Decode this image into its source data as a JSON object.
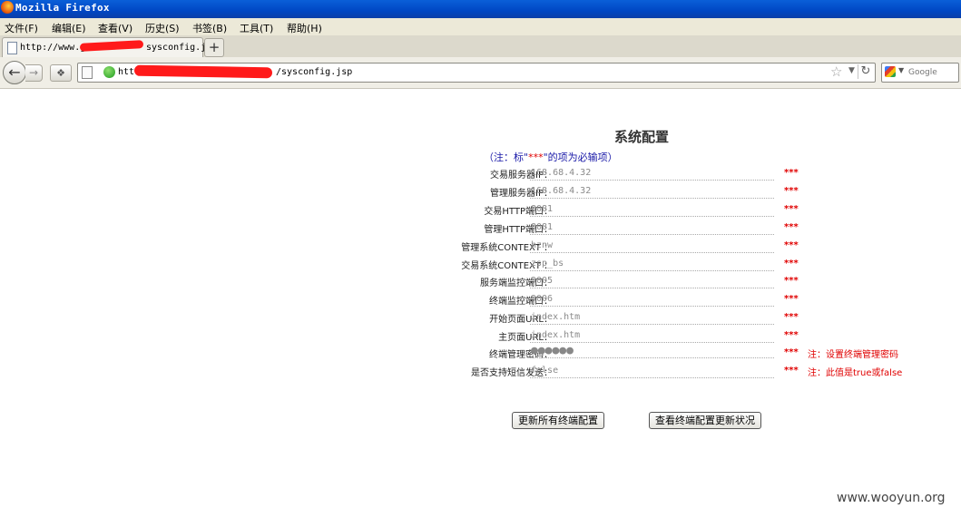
{
  "window": {
    "title": "Mozilla Firefox"
  },
  "menubar": {
    "items": [
      "文件(F)",
      "编辑(E)",
      "查看(V)",
      "历史(S)",
      "书签(B)",
      "工具(T)",
      "帮助(H)"
    ]
  },
  "tab": {
    "label_prefix": "http://www.gne",
    "label_suffix": "sysconfig.jsp",
    "new_tab": "+"
  },
  "nav": {
    "url_prefix": "htt",
    "url_suffix": "/sysconfig.jsp",
    "search_placeholder": "Google"
  },
  "page": {
    "title": "系统配置",
    "note_prefix": "（注：标\"",
    "note_req": "***",
    "note_suffix": "\"的项为必输项）",
    "required_mark": "***",
    "fields": [
      {
        "label": "交易服务器IP：",
        "value": "168.68.4.32",
        "hint": ""
      },
      {
        "label": "管理服务器IP：",
        "value": "168.68.4.32",
        "hint": ""
      },
      {
        "label": "交易HTTP端口：",
        "value": "8081",
        "hint": ""
      },
      {
        "label": "管理HTTP端口：",
        "value": "8081",
        "hint": ""
      },
      {
        "label": "管理系统CONTEXT ：",
        "value": "hznw",
        "hint": ""
      },
      {
        "label": "交易系统CONTEXT ：",
        "value": "zsp_bs",
        "hint": ""
      },
      {
        "label": "服务端监控端口：",
        "value": "9005",
        "hint": ""
      },
      {
        "label": "终端监控端口：",
        "value": "9006",
        "hint": ""
      },
      {
        "label": "开始页面URL：",
        "value": "index.htm",
        "hint": ""
      },
      {
        "label": "主页面URL：",
        "value": "index.htm",
        "hint": ""
      },
      {
        "label": "终端管理密码：",
        "value": "●●●●●●",
        "hint": "注：设置终端管理密码"
      },
      {
        "label": "是否支持短信发送：",
        "value": "false",
        "hint": "注：此值是true或false"
      }
    ],
    "buttons": {
      "update_all": "更新所有终端配置",
      "view_status": "查看终端配置更新状况"
    }
  },
  "watermark": "www.wooyun.org"
}
